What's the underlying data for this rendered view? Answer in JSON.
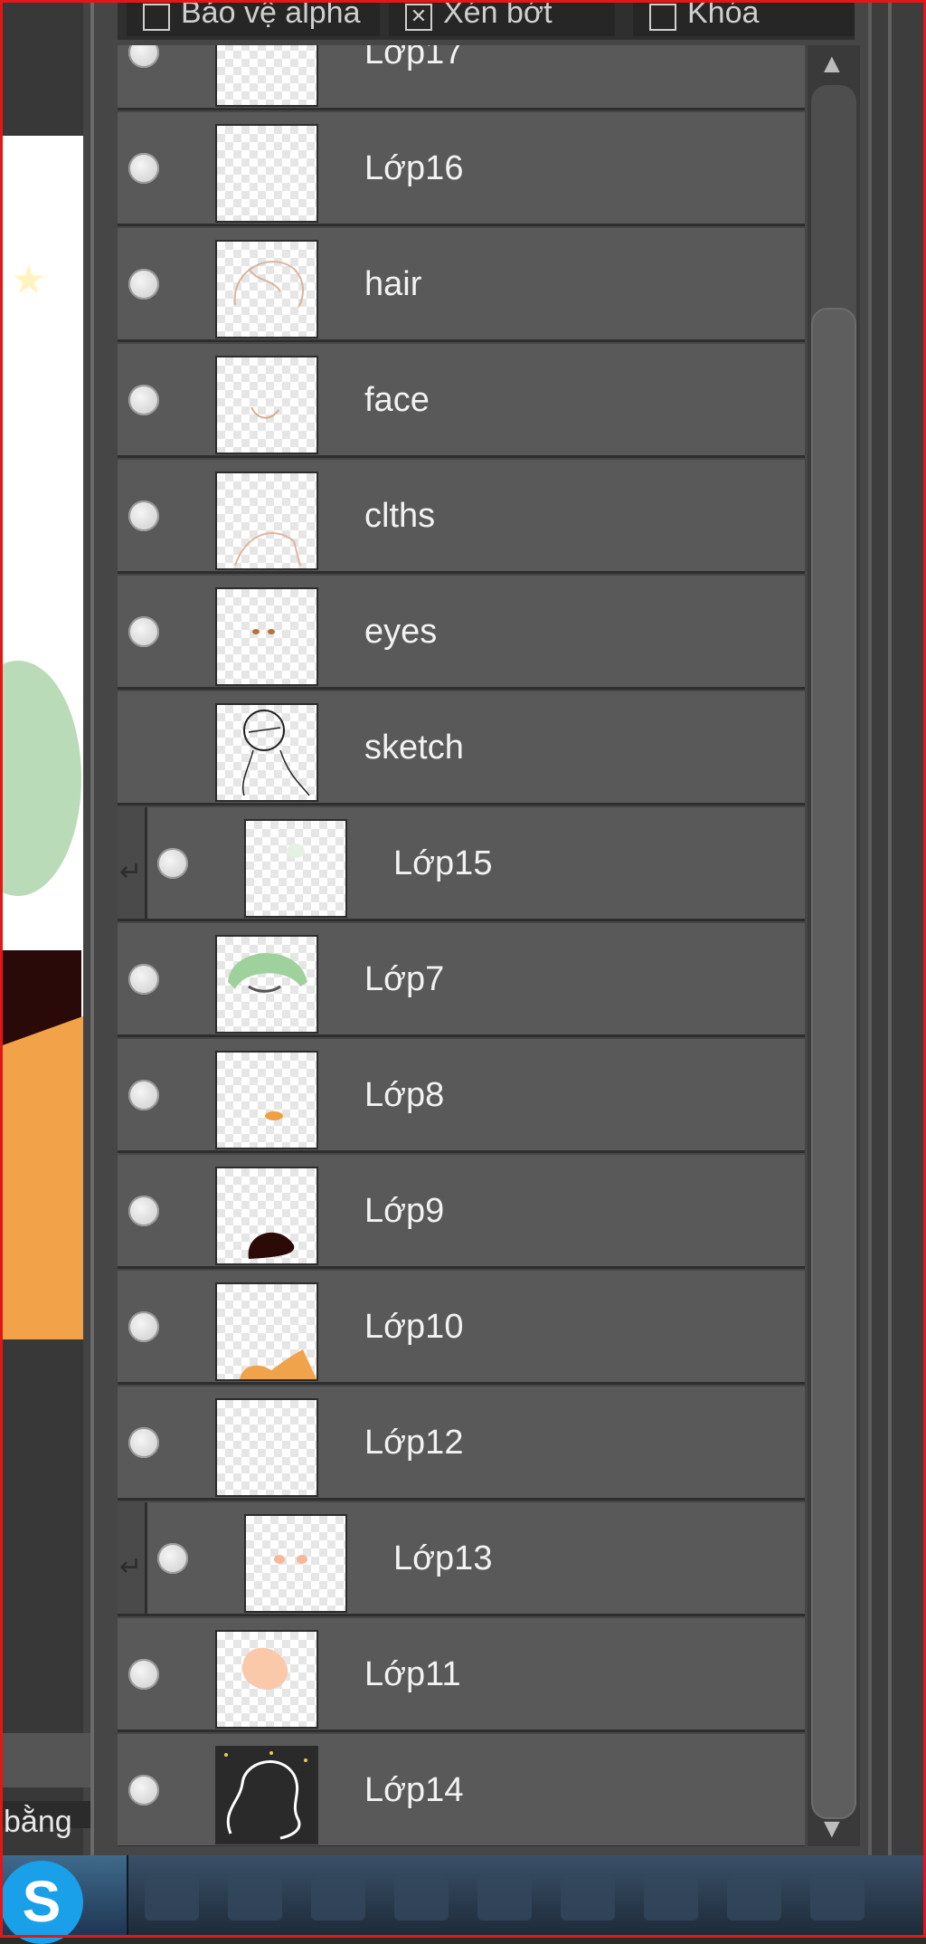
{
  "canvas": {
    "status_text": "bằng"
  },
  "layer_options": [
    {
      "label": "Bảo vệ alpha",
      "checked": false
    },
    {
      "label": "Xén bớt",
      "checked": true
    },
    {
      "label": "Khóa",
      "checked": false
    }
  ],
  "layers": [
    {
      "name": "Lớp17",
      "visible": true,
      "clipped": false,
      "thumb": "blank"
    },
    {
      "name": "Lớp16",
      "visible": true,
      "clipped": false,
      "thumb": "blank"
    },
    {
      "name": "hair",
      "visible": true,
      "clipped": false,
      "thumb": "hair-lines"
    },
    {
      "name": "face",
      "visible": true,
      "clipped": false,
      "thumb": "face-line"
    },
    {
      "name": "clths",
      "visible": true,
      "clipped": false,
      "thumb": "clothes-lines"
    },
    {
      "name": "eyes",
      "visible": true,
      "clipped": false,
      "thumb": "eye-dots"
    },
    {
      "name": "sketch",
      "visible": false,
      "clipped": false,
      "thumb": "sketch"
    },
    {
      "name": "Lớp15",
      "visible": true,
      "clipped": true,
      "thumb": "faint-green"
    },
    {
      "name": "Lớp7",
      "visible": true,
      "clipped": false,
      "thumb": "green-hair"
    },
    {
      "name": "Lớp8",
      "visible": true,
      "clipped": false,
      "thumb": "orange-dot"
    },
    {
      "name": "Lớp9",
      "visible": true,
      "clipped": false,
      "thumb": "dark-blob"
    },
    {
      "name": "Lớp10",
      "visible": true,
      "clipped": false,
      "thumb": "orange-shirt"
    },
    {
      "name": "Lớp12",
      "visible": true,
      "clipped": false,
      "thumb": "blank"
    },
    {
      "name": "Lớp13",
      "visible": true,
      "clipped": true,
      "thumb": "cheeks"
    },
    {
      "name": "Lớp11",
      "visible": true,
      "clipped": false,
      "thumb": "skin"
    },
    {
      "name": "Lớp14",
      "visible": true,
      "clipped": false,
      "thumb": "outline-white"
    }
  ],
  "taskbar": {
    "skype_label": "S"
  }
}
